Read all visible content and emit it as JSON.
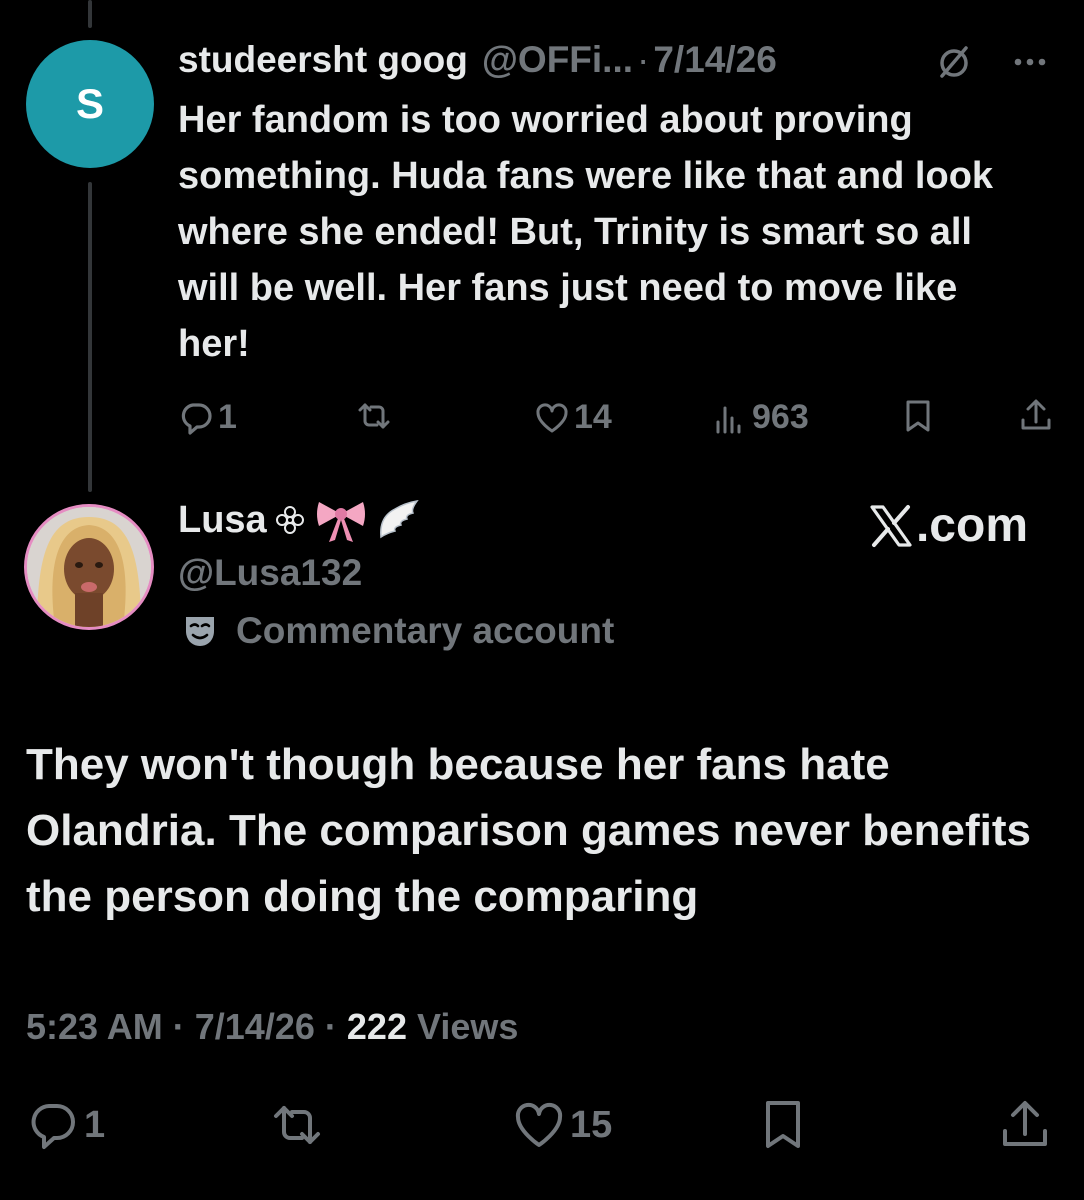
{
  "reply": {
    "avatar_letter": "S",
    "name": "studeersht goog",
    "handle": "@OFFi...",
    "separator": "·",
    "date": "7/14/26",
    "text": "Her fandom is too worried about proving something. Huda fans were like that and look where she ended! But, Trinity is smart so all will be well. Her fans just need to move like her!",
    "actions": {
      "replies": "1",
      "reposts": "",
      "likes": "14",
      "views": "963"
    }
  },
  "post": {
    "name": "Lusa",
    "emojis": [
      "flower",
      "pink-bow",
      "wing"
    ],
    "handle": "@Lusa132",
    "label": "Commentary account",
    "watermark": ".com",
    "text": "They won't though because her fans hate Olandria. The comparison games never benefits the person doing the comparing",
    "time": "5:23 AM",
    "date": "7/14/26",
    "separator": "·",
    "views_count": "222",
    "views_label": "Views",
    "actions": {
      "replies": "1",
      "reposts": "",
      "likes": "15"
    }
  },
  "colors": {
    "background": "#000000",
    "text_primary": "#e7e9ea",
    "text_secondary": "#71767b",
    "avatar_teal": "#1d9aa8",
    "thread_line": "#333639"
  }
}
